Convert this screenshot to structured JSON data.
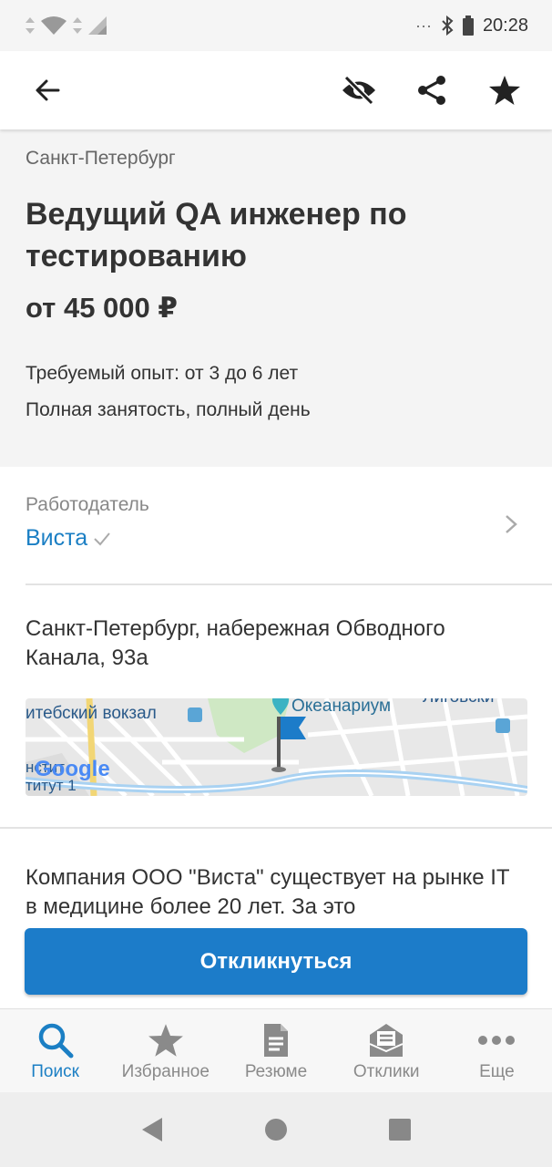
{
  "status_bar": {
    "time": "20:28"
  },
  "app_bar": {
    "back_icon": "arrow-left-icon",
    "hide_icon": "eye-off-icon",
    "share_icon": "share-icon",
    "favorite_icon": "star-icon"
  },
  "vacancy": {
    "city": "Санкт-Петербург",
    "title": "Ведущий QA инженер по тестированию",
    "salary": "от 45 000 ₽",
    "experience": "Требуемый опыт: от 3 до 6 лет",
    "employment": "Полная занятость, полный день"
  },
  "employer": {
    "label": "Работодатель",
    "name": "Виста"
  },
  "address": "Санкт-Петербург, набережная Обводного Канала, 93а",
  "map": {
    "labels": {
      "station": "итебский вокзал",
      "poi": "Океанариум",
      "district": "Лиговски",
      "institute_line1": "нстит",
      "institute_line2": "титут 1"
    },
    "logo": "Google"
  },
  "description": "Компания ООО \"Виста\" существует на рынке IT в медицине более 20 лет. За это",
  "cta": {
    "label": "Откликнуться"
  },
  "tabs": [
    {
      "label": "Поиск",
      "icon": "search-icon",
      "active": true
    },
    {
      "label": "Избранное",
      "icon": "star-icon",
      "active": false
    },
    {
      "label": "Резюме",
      "icon": "document-icon",
      "active": false
    },
    {
      "label": "Отклики",
      "icon": "inbox-icon",
      "active": false
    },
    {
      "label": "Еще",
      "icon": "more-icon",
      "active": false
    }
  ],
  "colors": {
    "accent": "#1c7cc9",
    "link": "#1b7fc4"
  }
}
